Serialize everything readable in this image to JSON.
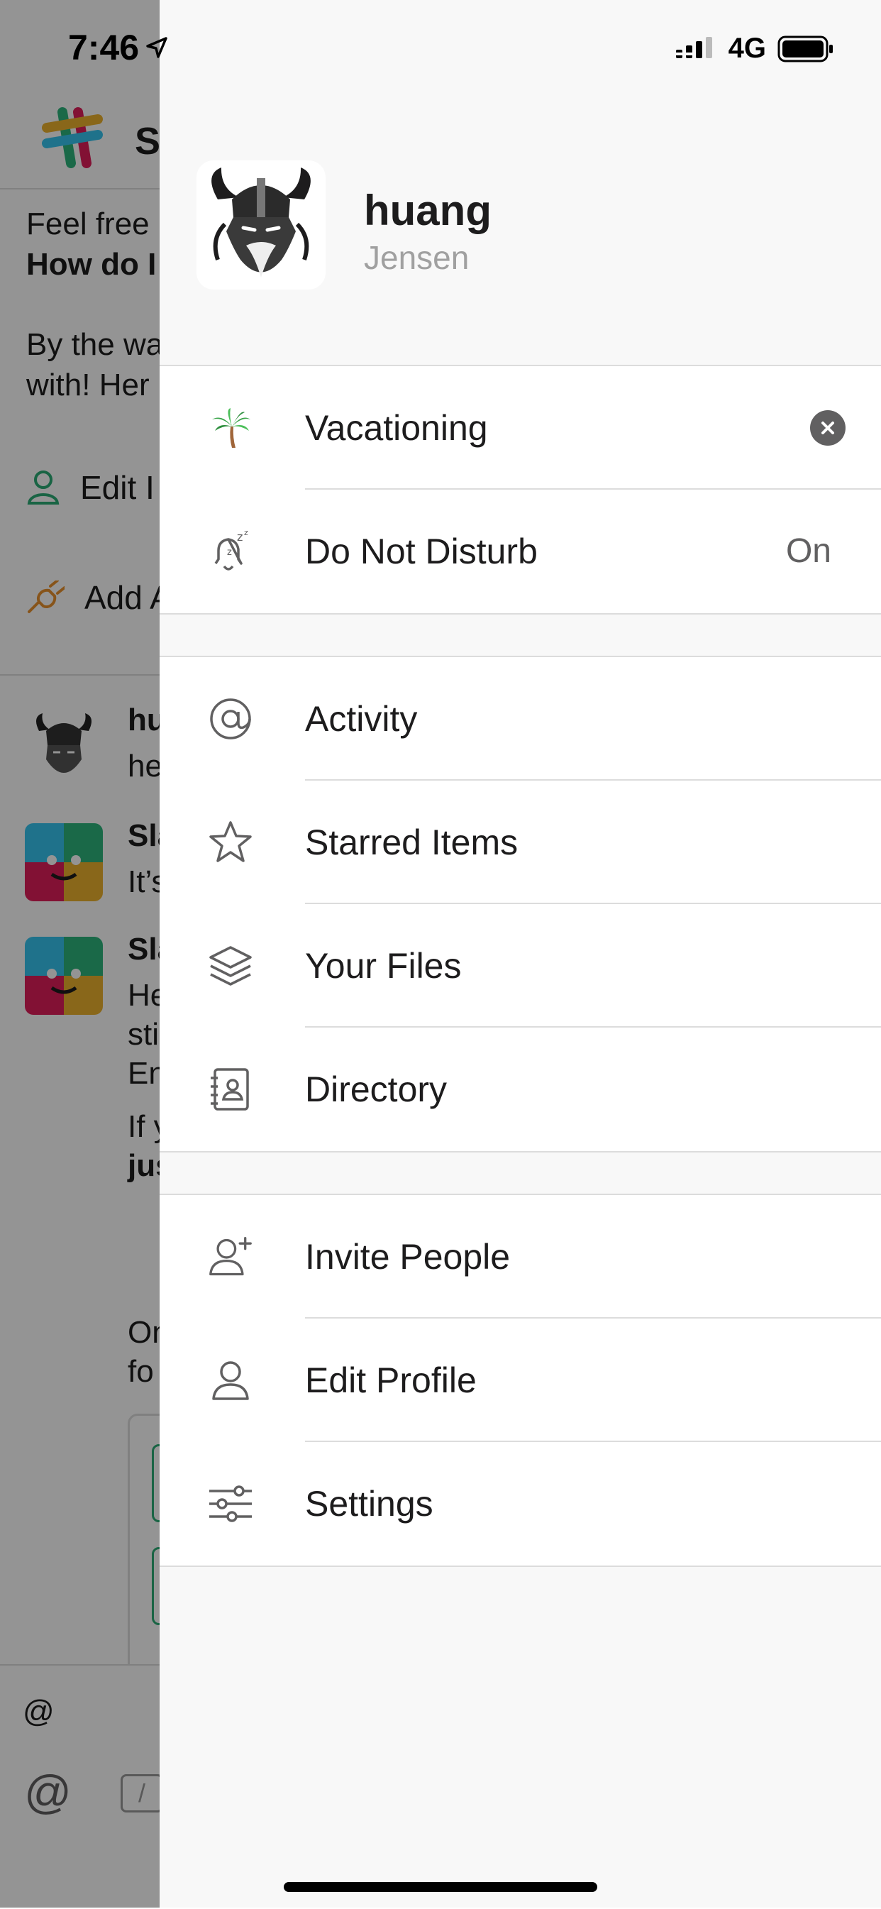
{
  "status_bar": {
    "time": "7:46",
    "network": "4G"
  },
  "background": {
    "title": "Sl",
    "intro_line1": "Feel free",
    "intro_line2": "How do I",
    "intro_line3": "By the wa",
    "intro_line4": "with! Her",
    "edit_link": "Edit I",
    "add_link": "Add A",
    "msg1_name": "hu",
    "msg1_text": "he",
    "msg2_name": "Sla",
    "msg2_text": "It’s",
    "msg3_name": "Sla",
    "msg3_line1": "He",
    "msg3_line2": "sti",
    "msg3_line3": "En",
    "msg3_line4": "If y",
    "msg3_line5": "jus",
    "msg3_line6": "On",
    "msg3_line7": "fo",
    "compose_at": "@",
    "compose_mention_icon": "@",
    "compose_slash": "/"
  },
  "profile": {
    "username": "huang",
    "real_name": "Jensen"
  },
  "status_row": {
    "emoji": "🌴",
    "label": "Vacationing",
    "icon": "palm-tree-icon"
  },
  "dnd_row": {
    "label": "Do Not Disturb",
    "value": "On",
    "icon": "bell-snooze-icon"
  },
  "menu": {
    "activity": "Activity",
    "starred": "Starred Items",
    "files": "Your Files",
    "directory": "Directory",
    "invite": "Invite People",
    "edit_profile": "Edit Profile",
    "settings": "Settings"
  },
  "colors": {
    "icon_gray": "#616061",
    "text": "#1d1c1d",
    "drawer_bg": "#f8f8f8",
    "accent_green": "#2bac76"
  }
}
